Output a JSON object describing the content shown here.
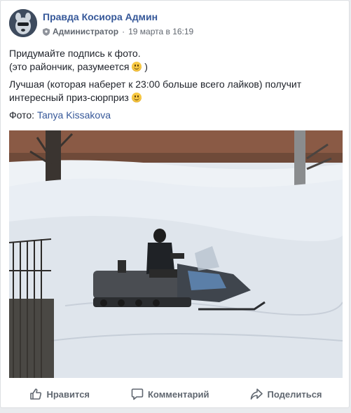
{
  "post": {
    "author": "Правда Косиора Админ",
    "role": "Администратор",
    "separator": "·",
    "timestamp": "19 марта в 16:19",
    "text": {
      "line1": "Придумайте подпись к фото.",
      "line2_before": "(это райончик, разумеется",
      "line2_after": ")",
      "line3": "Лучшая (которая наберет к 23:00 больше всего лайков) получит",
      "line4": "интересный приз-сюрприз",
      "credit_label": "Фото:",
      "credit_name": "Tanya Kissakova"
    },
    "emoji_icon": "smiley-emoji-icon",
    "photo_icon": "snowmobile-photo"
  },
  "actions": {
    "like": {
      "label": "Нравится",
      "icon": "thumbs-up-icon"
    },
    "comment": {
      "label": "Комментарий",
      "icon": "comment-bubble-icon"
    },
    "share": {
      "label": "Поделиться",
      "icon": "share-arrow-icon"
    }
  },
  "colors": {
    "link": "#365899",
    "meta": "#616770",
    "background": "#e9ebee"
  }
}
